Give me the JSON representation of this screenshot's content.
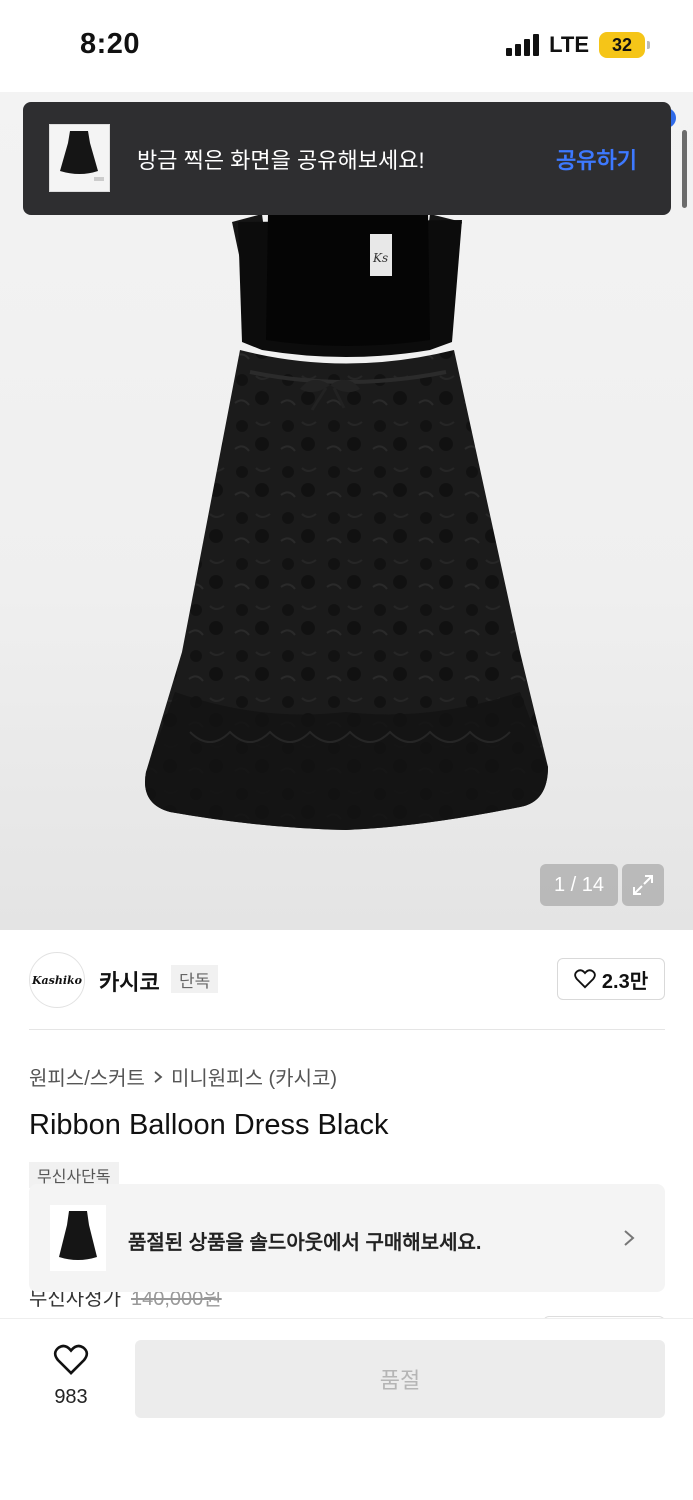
{
  "status_bar": {
    "time": "8:20",
    "network": "LTE",
    "battery": "32"
  },
  "share_toast": {
    "message": "방금 찍은 화면을 공유해보세요!",
    "action": "공유하기"
  },
  "gallery": {
    "counter": "1 / 14",
    "expand_icon": "expand-icon"
  },
  "brand": {
    "logo_text": "Kashiko",
    "name": "카시코",
    "badge": "단독",
    "like_count": "2.3만"
  },
  "breadcrumb": {
    "category": "원피스/스커트",
    "subcategory": "미니원피스 (카시코)"
  },
  "product": {
    "title": "Ribbon Balloon Dress Black",
    "exclusive_badge": "무신사단독",
    "price_label": "무신사정가",
    "price_value": "140,000원"
  },
  "soldout_banner": {
    "message": "품절된 상품을 솔드아웃에서 구매해보세요."
  },
  "bottom_bar": {
    "wish_count": "983",
    "buy_label": "품절"
  },
  "colors": {
    "accent_blue": "#3d79ff",
    "toast_bg": "#2e2e30",
    "battery": "#f5c518"
  }
}
